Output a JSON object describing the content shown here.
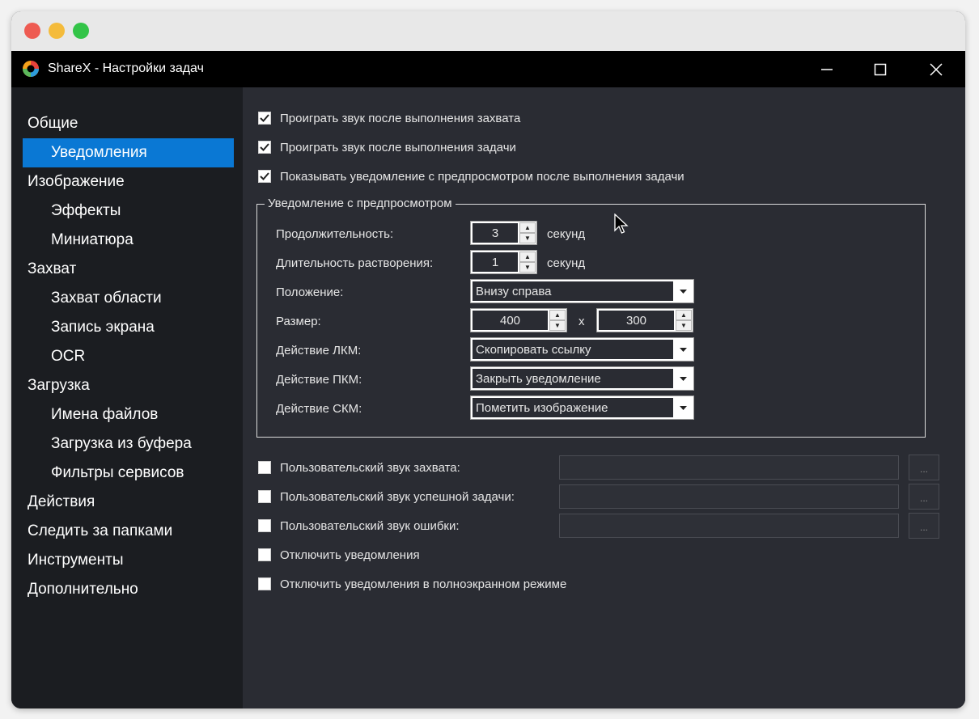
{
  "window": {
    "title": "ShareX - Настройки задач"
  },
  "sidebar": {
    "items": [
      {
        "label": "Общие",
        "level": 0
      },
      {
        "label": "Уведомления",
        "level": 1,
        "selected": true
      },
      {
        "label": "Изображение",
        "level": 0
      },
      {
        "label": "Эффекты",
        "level": 1
      },
      {
        "label": "Миниатюра",
        "level": 1
      },
      {
        "label": "Захват",
        "level": 0
      },
      {
        "label": "Захват области",
        "level": 1
      },
      {
        "label": "Запись экрана",
        "level": 1
      },
      {
        "label": "OCR",
        "level": 1
      },
      {
        "label": "Загрузка",
        "level": 0
      },
      {
        "label": "Имена файлов",
        "level": 1
      },
      {
        "label": "Загрузка из буфера",
        "level": 1
      },
      {
        "label": "Фильтры сервисов",
        "level": 1
      },
      {
        "label": "Действия",
        "level": 0
      },
      {
        "label": "Следить за папками",
        "level": 0
      },
      {
        "label": "Инструменты",
        "level": 0
      },
      {
        "label": "Дополнительно",
        "level": 0
      }
    ]
  },
  "checks_top": [
    {
      "label": "Проиграть звук после выполнения захвата",
      "checked": true
    },
    {
      "label": "Проиграть звук после выполнения задачи",
      "checked": true
    },
    {
      "label": "Показывать уведомление с предпросмотром после выполнения задачи",
      "checked": true
    }
  ],
  "preview_group": {
    "title": "Уведомление с предпросмотром",
    "duration": {
      "label": "Продолжительность:",
      "value": "3",
      "unit": "секунд"
    },
    "fade": {
      "label": "Длительность растворения:",
      "value": "1",
      "unit": "секунд"
    },
    "position": {
      "label": "Положение:",
      "value": "Внизу справа"
    },
    "size": {
      "label": "Размер:",
      "width": "400",
      "separator": "x",
      "height": "300"
    },
    "lmb": {
      "label": "Действие ЛКМ:",
      "value": "Скопировать ссылку"
    },
    "rmb": {
      "label": "Действие ПКМ:",
      "value": "Закрыть уведомление"
    },
    "mmb": {
      "label": "Действие СКМ:",
      "value": "Пометить изображение"
    }
  },
  "custom_sounds": [
    {
      "label": "Пользовательский звук захвата:",
      "checked": false,
      "path": "",
      "button": "..."
    },
    {
      "label": "Пользовательский звук успешной задачи:",
      "checked": false,
      "path": "",
      "button": "..."
    },
    {
      "label": "Пользовательский звук ошибки:",
      "checked": false,
      "path": "",
      "button": "..."
    }
  ],
  "checks_bottom": [
    {
      "label": "Отключить уведомления",
      "checked": false
    },
    {
      "label": "Отключить уведомления в полноэкранном режиме",
      "checked": false
    }
  ],
  "colors": {
    "selected": "#0a78d4",
    "sidebar_bg": "#1b1d21",
    "content_bg": "#2a2c33"
  }
}
